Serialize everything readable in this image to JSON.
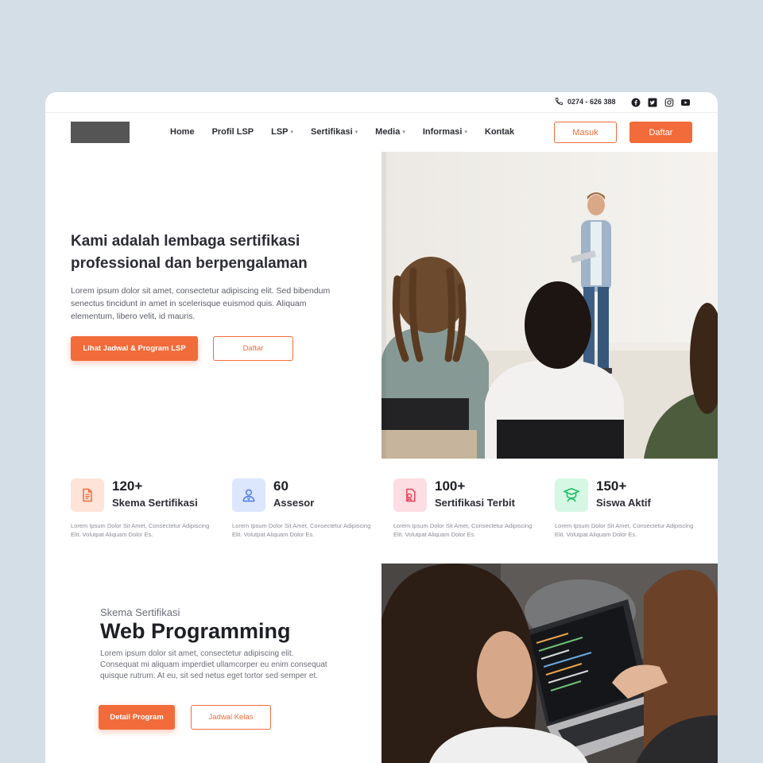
{
  "topbar": {
    "phone": "0274 - 626 388",
    "socials": [
      "facebook-icon",
      "twitter-icon",
      "instagram-icon",
      "youtube-icon"
    ]
  },
  "nav": {
    "items": [
      {
        "label": "Home",
        "dropdown": false
      },
      {
        "label": "Profil LSP",
        "dropdown": false
      },
      {
        "label": "LSP",
        "dropdown": true
      },
      {
        "label": "Sertifikasi",
        "dropdown": true
      },
      {
        "label": "Media",
        "dropdown": true
      },
      {
        "label": "Informasi",
        "dropdown": true
      },
      {
        "label": "Kontak",
        "dropdown": false
      }
    ],
    "login_label": "Masuk",
    "register_label": "Daftar"
  },
  "hero": {
    "title": "Kami adalah lembaga sertifikasi professional dan berpengalaman",
    "description": "Lorem ipsum dolor sit amet, consectetur adipiscing elit. Sed bibendum senectus tincidunt in amet in scelerisque euismod quis. Aliquam elementum, libero velit, id mauris.",
    "primary_button": "Lihat Jadwal & Program LSP",
    "secondary_button": "Daftar"
  },
  "stats": [
    {
      "number": "120+",
      "label": "Skema Sertifikasi",
      "desc": "Lorem Ipsum Dolor Sit Amet, Consectetur Adipiscing Elit. Volutpat Aliquam Dolor Es.",
      "icon": "document-icon",
      "color": "#f26b3a",
      "bg": "#fde3d8"
    },
    {
      "number": "60",
      "label": "Assesor",
      "desc": "Lorem Ipsum Dolor Sit Amet, Consectetur Adipiscing Elit. Volutpat Aliquam Dolor Es.",
      "icon": "user-icon",
      "color": "#4a7cf0",
      "bg": "#dce6fd"
    },
    {
      "number": "100+",
      "label": "Sertifikasi Terbit",
      "desc": "Lorem Ipsum Dolor Sit Amet, Consectetur Adipiscing Elit. Volutpat Aliquam Dolor Es.",
      "icon": "certificate-icon",
      "color": "#e8455a",
      "bg": "#fcdde2"
    },
    {
      "number": "150+",
      "label": "Siswa Aktif",
      "desc": "Lorem Ipsum Dolor Sit Amet, Consectetur Adipiscing Elit. Volutpat Aliquam Dolor Es.",
      "icon": "graduate-icon",
      "color": "#1fbf6a",
      "bg": "#d6f7e4"
    }
  ],
  "program": {
    "subtitle": "Skema Sertifikasi",
    "title": "Web Programming",
    "description": "Lorem ipsum dolor sit amet, consectetur adipiscing elit. Consequat mi aliquam imperdiet ullamcorper eu enim consequat quisque rutrum. At eu, sit sed netus eget tortor sed semper et.",
    "primary_button": "Detail Program",
    "secondary_button": "Jadwal Kelas"
  },
  "colors": {
    "accent": "#f26b3a",
    "background": "#d3dee6"
  }
}
